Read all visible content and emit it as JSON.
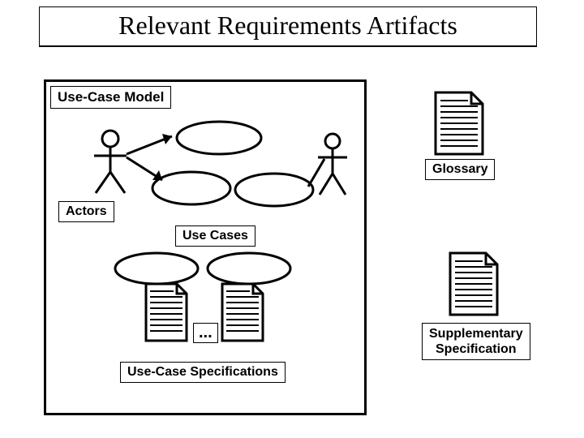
{
  "title": "Relevant Requirements Artifacts",
  "labels": {
    "use_case_model": "Use-Case Model",
    "actors": "Actors",
    "use_cases": "Use Cases",
    "use_case_specifications": "Use-Case Specifications",
    "glossary": "Glossary",
    "supplementary_specification": "Supplementary\nSpecification",
    "ellipsis": "..."
  }
}
